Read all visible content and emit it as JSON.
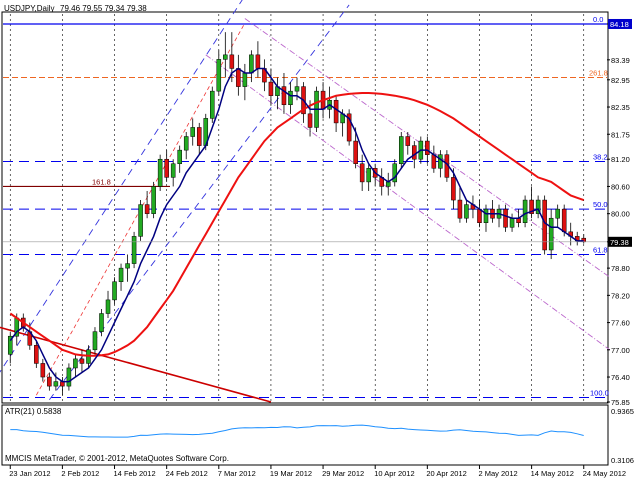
{
  "header": {
    "symbol_label": "USDJPY,Daily",
    "ohlc_label": "79.46 79.55 79.34 79.38"
  },
  "footer": {
    "copyright": "MMCIS MetaTrader, © 2001-2012, MetaQuotes Software Corp."
  },
  "indicator": {
    "label": "ATR(21) 0.5838",
    "axis_max": "0.9365",
    "axis_min": "0.3106",
    "ymin": 0.3106,
    "ymax": 0.9365,
    "color": "#1e90ff"
  },
  "colors": {
    "bull": "#22aa22",
    "bear": "#dd1111",
    "ma_slow": "#ee1111",
    "ma_fast": "#000080",
    "fib": "#0000ee",
    "trend_red": "#cc0000",
    "channel": "#3333dd",
    "dashdot": "#bb66cc"
  },
  "chart_data": {
    "type": "candlestick",
    "symbol": "USDJPY",
    "timeframe": "Daily",
    "ylim": [
      75.85,
      84.4
    ],
    "y_ticks": [
      "84.18",
      "83.39",
      "82.95",
      "82.35",
      "81.75",
      "81.20",
      "80.60",
      "80.00",
      "79.38",
      "78.80",
      "78.20",
      "77.60",
      "77.00",
      "76.40",
      "75.85"
    ],
    "x_ticks": [
      "23 Jan 2012",
      "2 Feb 2012",
      "14 Feb 2012",
      "24 Feb 2012",
      "7 Mar 2012",
      "19 Mar 2012",
      "29 Mar 2012",
      "10 Apr 2012",
      "20 Apr 2012",
      "2 May 2012",
      "14 May 2012",
      "24 May 2012"
    ],
    "x_tick_index": [
      0,
      8,
      16,
      24,
      32,
      40,
      48,
      56,
      64,
      72,
      80,
      88
    ],
    "current_price": "79.38",
    "candles": [
      [
        76.9,
        77.4,
        76.7,
        77.3
      ],
      [
        77.3,
        77.8,
        77.1,
        77.7
      ],
      [
        77.7,
        77.8,
        77.4,
        77.5
      ],
      [
        77.4,
        77.6,
        77.0,
        77.1
      ],
      [
        77.1,
        77.2,
        76.6,
        76.7
      ],
      [
        76.7,
        76.8,
        76.3,
        76.4
      ],
      [
        76.4,
        76.5,
        76.1,
        76.2
      ],
      [
        76.2,
        76.5,
        76.1,
        76.3
      ],
      [
        76.3,
        76.4,
        76.0,
        76.2
      ],
      [
        76.2,
        76.7,
        76.1,
        76.6
      ],
      [
        76.6,
        76.9,
        76.4,
        76.8
      ],
      [
        76.8,
        77.0,
        76.5,
        76.7
      ],
      [
        76.7,
        77.1,
        76.6,
        77.0
      ],
      [
        77.0,
        77.5,
        76.9,
        77.4
      ],
      [
        77.4,
        77.9,
        77.3,
        77.8
      ],
      [
        77.8,
        78.3,
        77.7,
        78.1
      ],
      [
        78.1,
        78.6,
        78.0,
        78.5
      ],
      [
        78.5,
        78.9,
        78.3,
        78.8
      ],
      [
        78.8,
        79.1,
        78.5,
        78.9
      ],
      [
        78.9,
        79.6,
        78.8,
        79.5
      ],
      [
        79.5,
        80.3,
        79.4,
        80.2
      ],
      [
        80.2,
        80.5,
        79.9,
        80.0
      ],
      [
        80.0,
        80.7,
        79.9,
        80.6
      ],
      [
        80.6,
        81.3,
        80.5,
        81.2
      ],
      [
        81.2,
        81.4,
        80.7,
        80.8
      ],
      [
        80.8,
        81.2,
        80.6,
        81.1
      ],
      [
        81.1,
        81.5,
        80.9,
        81.4
      ],
      [
        81.4,
        81.8,
        81.2,
        81.7
      ],
      [
        81.7,
        82.1,
        81.5,
        81.9
      ],
      [
        81.9,
        82.0,
        81.3,
        81.5
      ],
      [
        81.5,
        82.2,
        81.4,
        82.1
      ],
      [
        82.1,
        82.8,
        82.0,
        82.7
      ],
      [
        82.7,
        83.6,
        82.6,
        83.4
      ],
      [
        83.4,
        84.0,
        83.0,
        83.5
      ],
      [
        83.5,
        84.0,
        82.9,
        83.2
      ],
      [
        83.2,
        83.5,
        82.6,
        82.8
      ],
      [
        82.8,
        83.3,
        82.5,
        83.1
      ],
      [
        83.1,
        83.6,
        82.9,
        83.5
      ],
      [
        83.5,
        83.8,
        83.0,
        83.2
      ],
      [
        83.2,
        83.4,
        82.7,
        82.9
      ],
      [
        82.9,
        83.2,
        82.4,
        82.6
      ],
      [
        82.6,
        83.0,
        82.3,
        82.8
      ],
      [
        82.8,
        83.1,
        82.2,
        82.4
      ],
      [
        82.4,
        82.9,
        82.2,
        82.7
      ],
      [
        82.7,
        83.0,
        82.5,
        82.8
      ],
      [
        82.8,
        82.9,
        82.0,
        82.2
      ],
      [
        82.2,
        82.5,
        81.7,
        81.9
      ],
      [
        81.9,
        82.8,
        81.8,
        82.7
      ],
      [
        82.7,
        82.9,
        82.1,
        82.3
      ],
      [
        82.3,
        82.8,
        82.1,
        82.5
      ],
      [
        82.5,
        82.6,
        81.8,
        82.0
      ],
      [
        82.0,
        82.3,
        81.7,
        82.2
      ],
      [
        82.2,
        82.3,
        81.5,
        81.6
      ],
      [
        81.6,
        81.9,
        81.0,
        81.1
      ],
      [
        81.1,
        81.3,
        80.5,
        80.7
      ],
      [
        80.7,
        81.1,
        80.5,
        81.0
      ],
      [
        81.0,
        81.1,
        80.6,
        80.8
      ],
      [
        80.8,
        81.0,
        80.4,
        80.6
      ],
      [
        80.6,
        80.9,
        80.4,
        80.7
      ],
      [
        80.7,
        81.2,
        80.6,
        81.1
      ],
      [
        81.1,
        81.8,
        81.0,
        81.7
      ],
      [
        81.7,
        81.8,
        81.3,
        81.5
      ],
      [
        81.5,
        81.6,
        81.0,
        81.2
      ],
      [
        81.2,
        81.7,
        81.1,
        81.6
      ],
      [
        81.6,
        81.7,
        81.1,
        81.3
      ],
      [
        81.3,
        81.5,
        80.9,
        81.0
      ],
      [
        81.0,
        81.4,
        80.8,
        81.3
      ],
      [
        81.3,
        81.4,
        80.7,
        80.8
      ],
      [
        80.8,
        81.0,
        80.1,
        80.3
      ],
      [
        80.3,
        80.6,
        79.8,
        79.9
      ],
      [
        79.9,
        80.3,
        79.8,
        80.2
      ],
      [
        80.2,
        80.4,
        79.9,
        80.1
      ],
      [
        80.1,
        80.3,
        79.7,
        79.8
      ],
      [
        79.8,
        80.2,
        79.6,
        80.1
      ],
      [
        80.1,
        80.3,
        79.8,
        79.9
      ],
      [
        79.9,
        80.2,
        79.7,
        80.1
      ],
      [
        80.1,
        80.2,
        79.6,
        79.7
      ],
      [
        79.7,
        80.0,
        79.6,
        79.9
      ],
      [
        79.9,
        80.1,
        79.7,
        79.8
      ],
      [
        79.8,
        80.4,
        79.7,
        80.3
      ],
      [
        80.3,
        80.6,
        79.9,
        80.0
      ],
      [
        80.0,
        80.4,
        79.9,
        80.3
      ],
      [
        80.3,
        80.4,
        79.1,
        79.2
      ],
      [
        79.2,
        80.1,
        79.0,
        79.9
      ],
      [
        79.9,
        80.2,
        79.7,
        80.1
      ],
      [
        80.1,
        80.2,
        79.5,
        79.6
      ],
      [
        79.6,
        79.8,
        79.3,
        79.5
      ],
      [
        79.5,
        79.6,
        79.3,
        79.4
      ],
      [
        79.46,
        79.55,
        79.34,
        79.38
      ]
    ],
    "series": [
      {
        "color": "#ee1111",
        "values": [
          77.8,
          77.7,
          77.6,
          77.5,
          77.4,
          77.3,
          77.2,
          77.1,
          77.0,
          76.95,
          76.9,
          76.88,
          76.87,
          76.87,
          76.88,
          76.9,
          76.95,
          77.02,
          77.1,
          77.2,
          77.35,
          77.5,
          77.7,
          77.9,
          78.1,
          78.3,
          78.55,
          78.8,
          79.05,
          79.3,
          79.55,
          79.8,
          80.05,
          80.3,
          80.55,
          80.8,
          81.0,
          81.2,
          81.4,
          81.6,
          81.75,
          81.9,
          82.0,
          82.1,
          82.2,
          82.3,
          82.38,
          82.45,
          82.5,
          82.55,
          82.6,
          82.62,
          82.64,
          82.65,
          82.66,
          82.66,
          82.65,
          82.64,
          82.62,
          82.6,
          82.57,
          82.54,
          82.5,
          82.45,
          82.4,
          82.33,
          82.26,
          82.18,
          82.1,
          82.0,
          81.9,
          81.8,
          81.7,
          81.6,
          81.5,
          81.4,
          81.3,
          81.2,
          81.1,
          81.0,
          80.9,
          80.8,
          80.75,
          80.7,
          80.6,
          80.5,
          80.4,
          80.35,
          80.3
        ]
      },
      {
        "color": "#000080",
        "values": [
          77.2,
          77.4,
          77.5,
          77.4,
          77.2,
          76.9,
          76.6,
          76.4,
          76.3,
          76.3,
          76.4,
          76.5,
          76.6,
          76.8,
          77.0,
          77.3,
          77.6,
          77.9,
          78.2,
          78.5,
          78.9,
          79.2,
          79.5,
          79.9,
          80.2,
          80.4,
          80.6,
          80.9,
          81.1,
          81.3,
          81.5,
          81.9,
          82.3,
          82.8,
          83.1,
          83.2,
          83.1,
          83.1,
          83.2,
          83.2,
          83.0,
          82.8,
          82.7,
          82.6,
          82.6,
          82.5,
          82.3,
          82.3,
          82.3,
          82.4,
          82.3,
          82.2,
          82.1,
          81.8,
          81.4,
          81.1,
          80.9,
          80.8,
          80.7,
          80.8,
          81.0,
          81.2,
          81.3,
          81.4,
          81.4,
          81.3,
          81.2,
          81.1,
          80.9,
          80.6,
          80.3,
          80.2,
          80.1,
          80.0,
          80.0,
          80.0,
          79.95,
          79.9,
          79.9,
          80.0,
          80.05,
          80.1,
          79.8,
          79.7,
          79.7,
          79.6,
          79.5,
          79.4,
          79.4
        ]
      }
    ],
    "fib_levels": [
      {
        "label": "0.0",
        "price": 84.18
      },
      {
        "label": "261.8",
        "price": 83.0
      },
      {
        "label": "38.2",
        "price": 81.15
      },
      {
        "label": "161.8",
        "price": 80.6
      },
      {
        "label": "50.0",
        "price": 80.1
      },
      {
        "label": "61.8",
        "price": 79.1
      },
      {
        "label": "100.0",
        "price": 75.95
      }
    ]
  }
}
